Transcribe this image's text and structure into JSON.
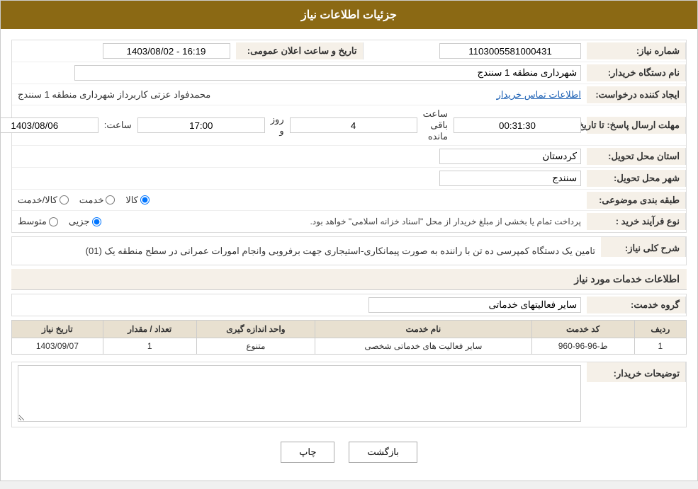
{
  "header": {
    "title": "جزئیات اطلاعات نیاز"
  },
  "fields": {
    "need_number_label": "شماره نیاز:",
    "need_number_value": "1103005581000431",
    "buyer_org_label": "نام دستگاه خریدار:",
    "buyer_org_value": "شهرداری منطقه 1 سنندج",
    "creator_label": "ایجاد کننده درخواست:",
    "creator_value": "محمدفواد عزتی کاربرداز شهرداری منطقه 1 سنندج",
    "contact_link": "اطلاعات تماس خریدار",
    "response_deadline_label": "مهلت ارسال پاسخ: تا تاریخ:",
    "response_date_value": "1403/08/06",
    "response_time_label": "ساعت:",
    "response_time_value": "17:00",
    "days_label": "روز و",
    "days_value": "4",
    "remaining_label": "ساعت باقی مانده",
    "remaining_value": "00:31:30",
    "announce_label": "تاریخ و ساعت اعلان عمومی:",
    "announce_value": "1403/08/02 - 16:19",
    "province_label": "استان محل تحویل:",
    "province_value": "کردستان",
    "city_label": "شهر محل تحویل:",
    "city_value": "سنندج",
    "category_label": "طبقه بندی موضوعی:",
    "category_kala": "کالا",
    "category_khadamat": "خدمت",
    "category_kala_khadamat": "کالا/خدمت",
    "process_type_label": "نوع فرآیند خرید :",
    "process_jozvi": "جزیی",
    "process_motavaset": "متوسط",
    "process_note": "پرداخت تمام یا بخشی از مبلغ خریدار از محل \"اسناد خزانه اسلامی\" خواهد بود.",
    "description_label": "شرح کلی نیاز:",
    "description_text": "تامین یک دستگاه کمپرسی ده تن با راننده به صورت پیمانکاری-استیجاری جهت برفروبی وانجام امورات عمرانی در سطح منطقه یک (01)",
    "services_section_title": "اطلاعات خدمات مورد نیاز",
    "service_group_label": "گروه خدمت:",
    "service_group_value": "سایر فعالیتهای خدماتی",
    "table_headers": [
      "ردیف",
      "کد خدمت",
      "نام خدمت",
      "واحد اندازه گیری",
      "تعداد / مقدار",
      "تاریخ نیاز"
    ],
    "table_rows": [
      {
        "row": "1",
        "code": "ط-96-96-960",
        "name": "سایر فعالیت های خدماتی شخصی",
        "unit": "متنوع",
        "count": "1",
        "date": "1403/09/07"
      }
    ],
    "buyer_notes_label": "توضیحات خریدار:",
    "buyer_notes_value": "",
    "btn_print": "چاپ",
    "btn_back": "بازگشت"
  }
}
